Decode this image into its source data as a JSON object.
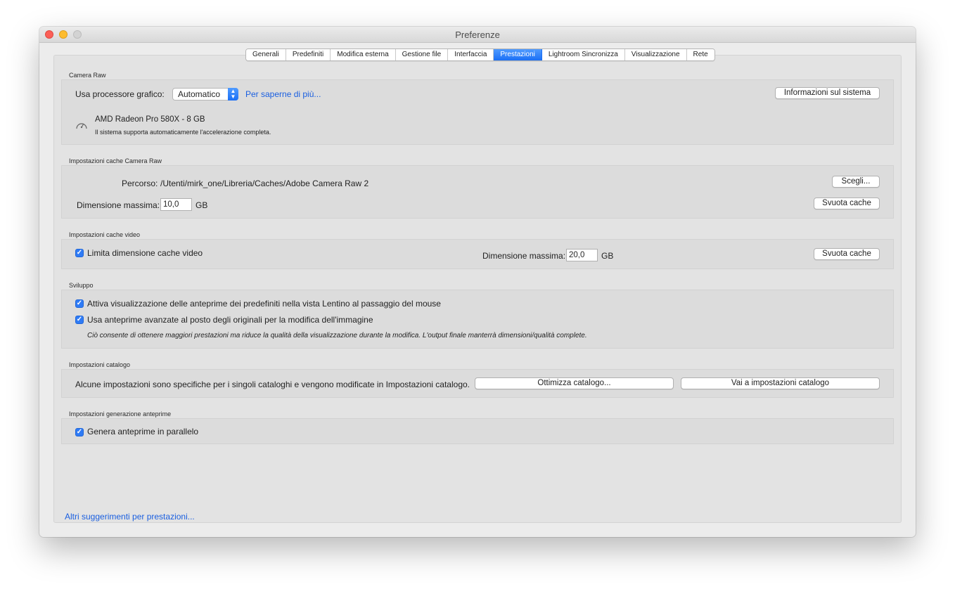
{
  "window": {
    "title": "Preferenze"
  },
  "tabs": [
    {
      "label": "Generali",
      "active": false
    },
    {
      "label": "Predefiniti",
      "active": false
    },
    {
      "label": "Modifica esterna",
      "active": false
    },
    {
      "label": "Gestione file",
      "active": false
    },
    {
      "label": "Interfaccia",
      "active": false
    },
    {
      "label": "Prestazioni",
      "active": true
    },
    {
      "label": "Lightroom Sincronizza",
      "active": false
    },
    {
      "label": "Visualizzazione",
      "active": false
    },
    {
      "label": "Rete",
      "active": false
    }
  ],
  "camera_raw": {
    "section_label": "Camera Raw",
    "gpu_label": "Usa processore grafico:",
    "gpu_value": "Automatico",
    "learn_more": "Per saperne di più...",
    "system_info_button": "Informazioni sul sistema",
    "gpu_name": "AMD Radeon Pro 580X - 8 GB",
    "gpu_status": "Il sistema supporta automaticamente l'accelerazione completa."
  },
  "cache_camera_raw": {
    "section_label": "Impostazioni cache Camera Raw",
    "path_label": "Percorso:",
    "path_value": "/Utenti/mirk_one/Libreria/Caches/Adobe Camera Raw 2",
    "choose_button": "Scegli...",
    "max_size_label": "Dimensione massima:",
    "max_size_value": "10,0",
    "unit": "GB",
    "purge_button": "Svuota cache"
  },
  "cache_video": {
    "section_label": "Impostazioni cache video",
    "limit_label": "Limita dimensione cache video",
    "limit_checked": true,
    "max_size_label": "Dimensione massima:",
    "max_size_value": "20,0",
    "unit": "GB",
    "purge_button": "Svuota cache"
  },
  "develop": {
    "section_label": "Sviluppo",
    "option1": "Attiva visualizzazione delle anteprime dei predefiniti nella vista Lentino al passaggio del mouse",
    "option1_checked": true,
    "option2": "Usa anteprime avanzate al posto degli originali per la modifica dell'immagine",
    "option2_checked": true,
    "note": "Ciò consente di ottenere maggiori prestazioni ma riduce la qualità della visualizzazione durante la modifica. L'output finale manterrà dimensioni/qualità complete."
  },
  "catalog": {
    "section_label": "Impostazioni catalogo",
    "description": "Alcune impostazioni sono specifiche per i singoli cataloghi e vengono modificate in Impostazioni catalogo.",
    "optimize_button": "Ottimizza catalogo...",
    "goto_button": "Vai a impostazioni catalogo"
  },
  "previews": {
    "section_label": "Impostazioni generazione anteprime",
    "parallel_label": "Genera anteprime in parallelo",
    "parallel_checked": true
  },
  "footer": {
    "more_tips_link": "Altri suggerimenti per prestazioni..."
  }
}
